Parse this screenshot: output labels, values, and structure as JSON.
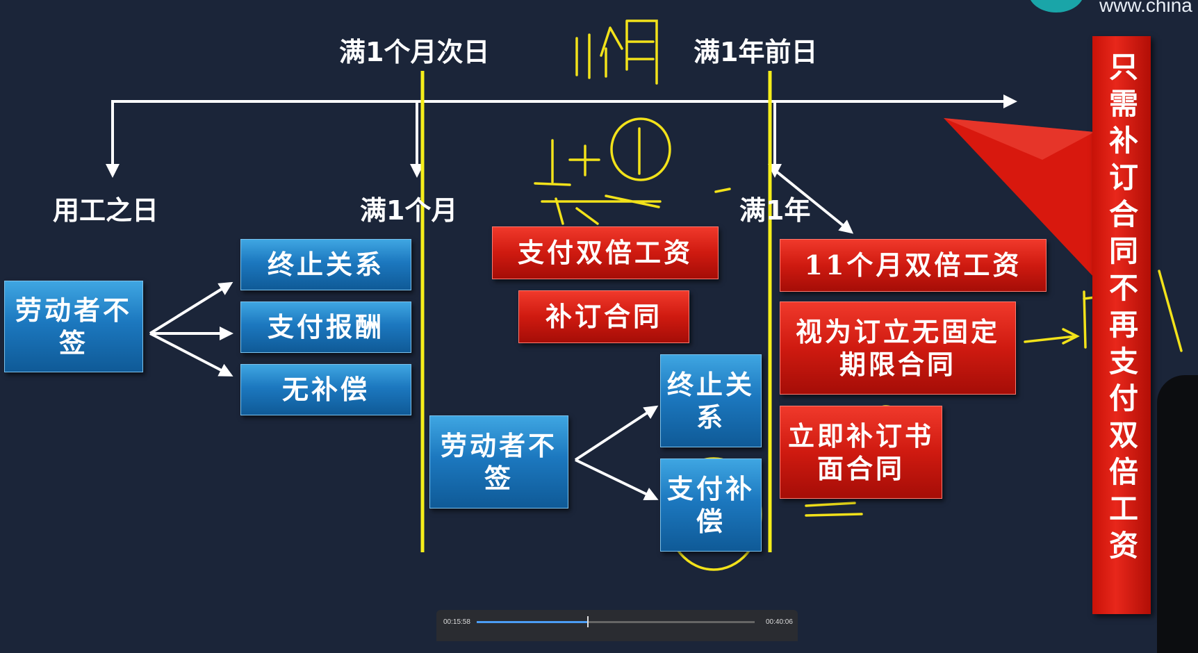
{
  "site": {
    "url": "www.china"
  },
  "timeline": {
    "top_label_1": "满1个月次日",
    "top_label_2": "满1年前日",
    "node_1": "用工之日",
    "node_2": "满1个月",
    "node_3": "满1年"
  },
  "left": {
    "source": "劳动者不签",
    "options": [
      "终止关系",
      "支付报酬",
      "无补偿"
    ]
  },
  "middle": {
    "penalty": "支付双倍工资",
    "remedy": "补订合同",
    "source": "劳动者不签",
    "options": [
      "终止关系",
      "支付补偿"
    ]
  },
  "right": {
    "boxes": [
      "11个月双倍工资",
      "视为订立无固定期限合同",
      "立即补订书面合同"
    ]
  },
  "banner": {
    "text": "只需补订合同不再支付双倍工资"
  },
  "player": {
    "elapsed": "00:15:58",
    "total": "00:40:06",
    "progress": 0.4
  },
  "colors": {
    "background": "#1b2539",
    "blue_box": "#1c78bf",
    "red_box": "#cf1a10",
    "yellow_line": "#f5ee1a",
    "handwriting": "#f2e21a"
  }
}
